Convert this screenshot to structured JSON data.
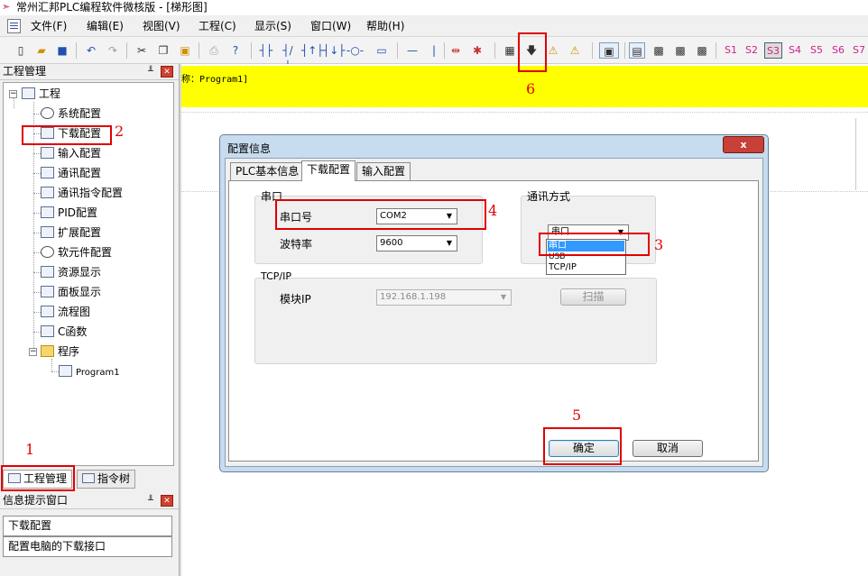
{
  "window": {
    "title": "常州汇邦PLC编程软件微核版 - [梯形图]"
  },
  "menu": [
    "文件(F)",
    "编辑(E)",
    "视图(V)",
    "工程(C)",
    "显示(S)",
    "窗口(W)",
    "帮助(H)"
  ],
  "toolbar": {
    "s_buttons": [
      "S1",
      "S2",
      "S3",
      "S4",
      "S5",
      "S6",
      "S7"
    ],
    "active_s": "S3"
  },
  "left_panel": {
    "title": "工程管理",
    "tree": {
      "root": "工程",
      "items": [
        "系统配置",
        "下载配置",
        "输入配置",
        "通讯配置",
        "通讯指令配置",
        "PID配置",
        "扩展配置",
        "软元件配置",
        "资源显示",
        "面板显示",
        "流程图",
        "C函数"
      ],
      "program_folder": "程序",
      "program_item": "Program1"
    },
    "tabs": [
      "工程管理",
      "指令树"
    ]
  },
  "info_panel": {
    "title": "信息提示窗口",
    "rows": [
      "下载配置",
      "配置电脑的下载接口"
    ]
  },
  "editor": {
    "program_label": "称：Program1]"
  },
  "dialog": {
    "title": "配置信息",
    "close": "x",
    "tabs": [
      "PLC基本信息",
      "下载配置",
      "输入配置"
    ],
    "active_tab": "下载配置",
    "serial_group": "串口",
    "port_label": "串口号",
    "port_value": "COM2",
    "baud_label": "波特率",
    "baud_value": "9600",
    "comm_group": "通讯方式",
    "comm_value": "串口",
    "comm_options": [
      "串口",
      "USB",
      "TCP/IP"
    ],
    "tcp_group": "TCP/IP",
    "ip_label": "模块IP",
    "ip_value": "192.168.1.198",
    "scan": "扫描",
    "ok": "确定",
    "cancel": "取消"
  },
  "annotations": [
    "1",
    "2",
    "3",
    "4",
    "5",
    "6"
  ],
  "colors": {
    "annotation": "#e00000",
    "highlight": "#ffff00",
    "selection": "#3399ff"
  }
}
